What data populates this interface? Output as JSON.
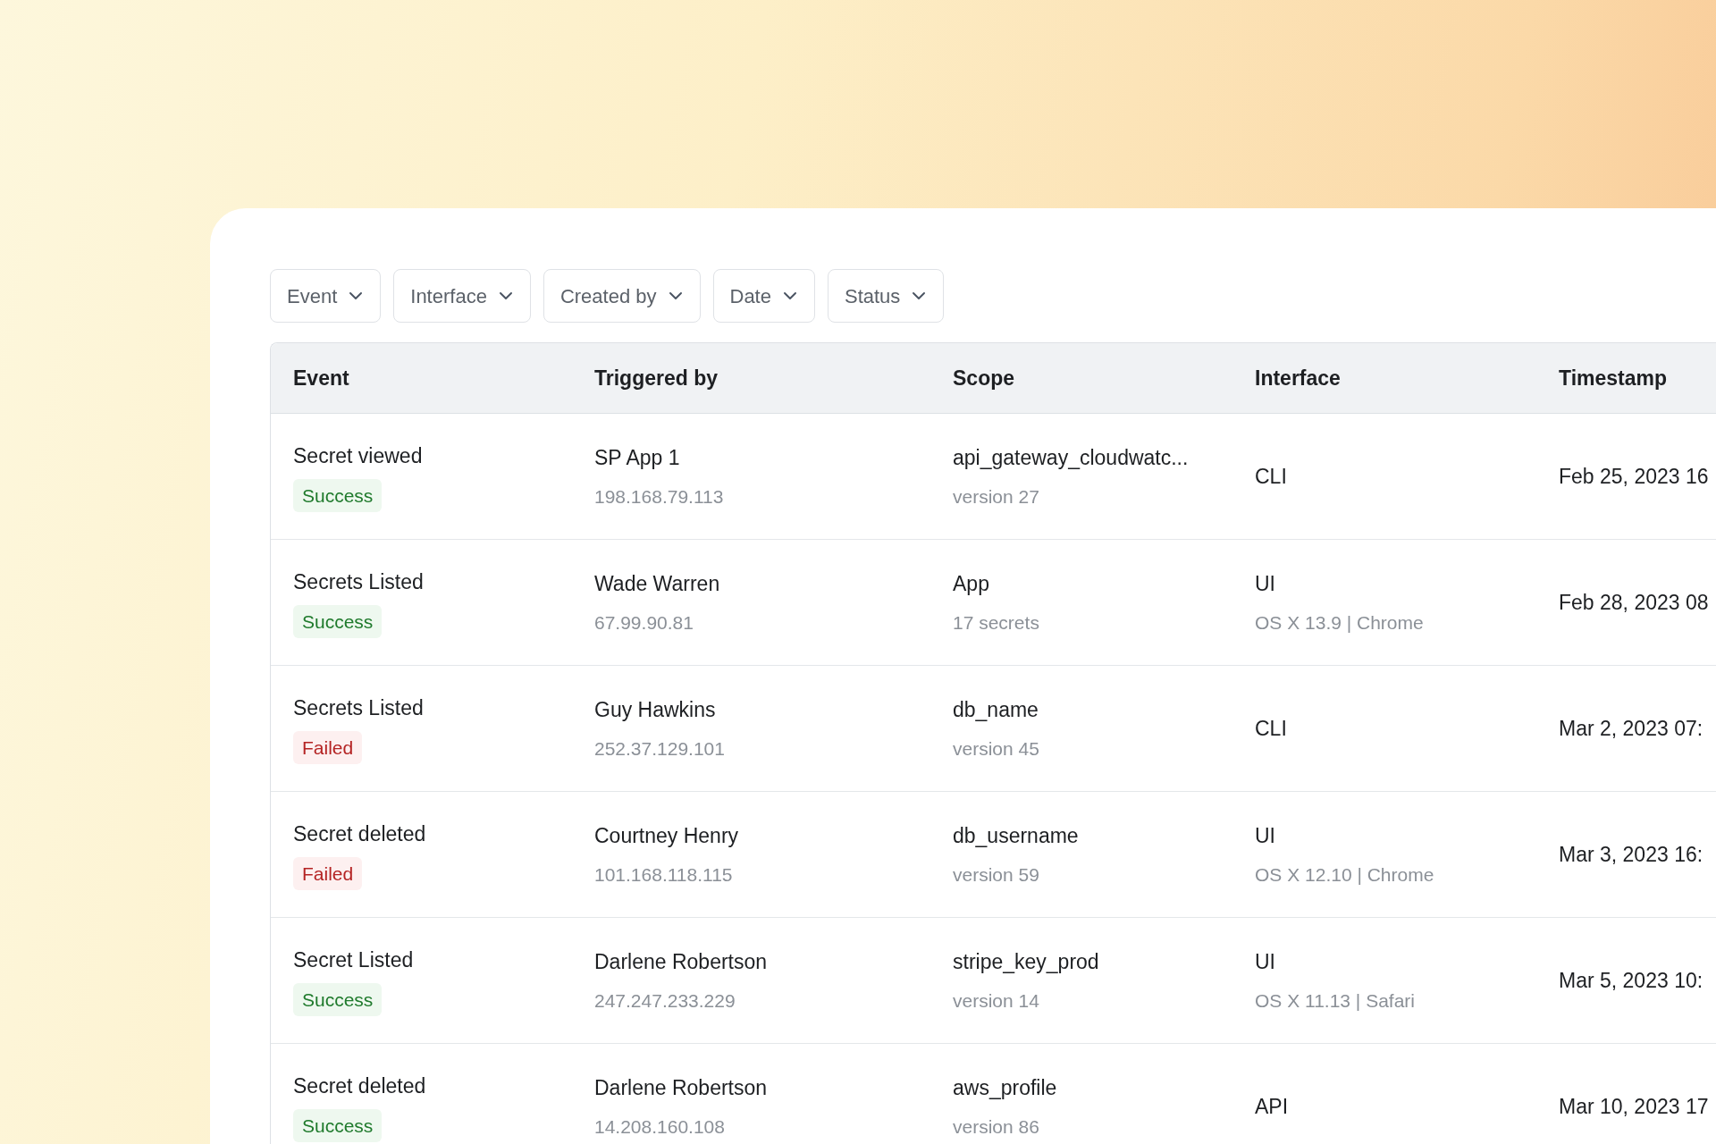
{
  "filters": [
    {
      "label": "Event"
    },
    {
      "label": "Interface"
    },
    {
      "label": "Created by"
    },
    {
      "label": "Date"
    },
    {
      "label": "Status"
    }
  ],
  "table": {
    "columns": [
      "Event",
      "Triggered by",
      "Scope",
      "Interface",
      "Timestamp"
    ],
    "rows": [
      {
        "event": "Secret viewed",
        "status": {
          "label": "Success",
          "kind": "success"
        },
        "triggered_by": "SP App 1",
        "ip": "198.168.79.113",
        "scope": "api_gateway_cloudwatc...",
        "scope_detail": "version 27",
        "interface": "CLI",
        "timestamp": "Feb 25, 2023 16"
      },
      {
        "event": "Secrets Listed",
        "status": {
          "label": "Success",
          "kind": "success"
        },
        "triggered_by": "Wade Warren",
        "ip": "67.99.90.81",
        "scope": "App",
        "scope_detail": "17 secrets",
        "interface": "UI",
        "interface_detail": "OS X 13.9 | Chrome",
        "timestamp": "Feb 28, 2023 08"
      },
      {
        "event": "Secrets Listed",
        "status": {
          "label": "Failed",
          "kind": "failed"
        },
        "triggered_by": "Guy Hawkins",
        "ip": "252.37.129.101",
        "scope": "db_name",
        "scope_detail": "version 45",
        "interface": "CLI",
        "timestamp": "Mar 2, 2023 07:"
      },
      {
        "event": "Secret deleted",
        "status": {
          "label": "Failed",
          "kind": "failed"
        },
        "triggered_by": "Courtney Henry",
        "ip": "101.168.118.115",
        "scope": "db_username",
        "scope_detail": "version 59",
        "interface": "UI",
        "interface_detail": "OS X 12.10 | Chrome",
        "timestamp": "Mar 3, 2023 16:"
      },
      {
        "event": "Secret Listed",
        "status": {
          "label": "Success",
          "kind": "success"
        },
        "triggered_by": "Darlene Robertson",
        "ip": "247.247.233.229",
        "scope": "stripe_key_prod",
        "scope_detail": "version 14",
        "interface": "UI",
        "interface_detail": "OS X 11.13 | Safari",
        "timestamp": "Mar 5, 2023 10:"
      },
      {
        "event": "Secret deleted",
        "status": {
          "label": "Success",
          "kind": "success"
        },
        "triggered_by": "Darlene Robertson",
        "ip": "14.208.160.108",
        "scope": "aws_profile",
        "scope_detail": "version 86",
        "interface": "API",
        "timestamp": "Mar 10, 2023 17"
      }
    ]
  }
}
